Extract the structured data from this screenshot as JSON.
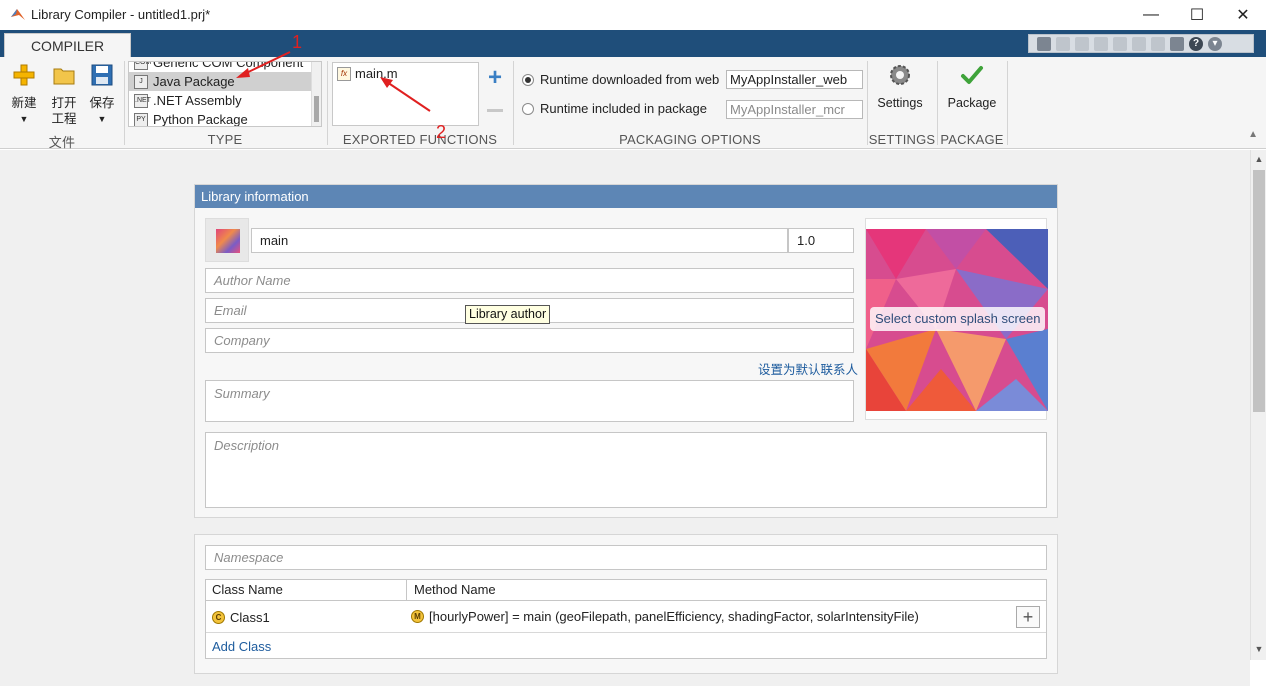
{
  "window": {
    "title": "Library Compiler - untitled1.prj*",
    "minimize": "—",
    "maximize": "☐",
    "close": "✕"
  },
  "tabs": {
    "compiler": "COMPILER"
  },
  "file_section": {
    "new_label": "新建",
    "open_label_1": "打开",
    "open_label_2": "工程",
    "save_label": "保存",
    "section_label": "文件"
  },
  "type_section": {
    "section_label": "TYPE",
    "items": [
      {
        "label": "Generic COM Component",
        "icon": "COM"
      },
      {
        "label": "Java Package",
        "icon": "J"
      },
      {
        "label": ".NET Assembly",
        "icon": ".NET"
      },
      {
        "label": "Python Package",
        "icon": "PY"
      }
    ],
    "selected": "Java Package"
  },
  "exported_functions": {
    "section_label": "EXPORTED FUNCTIONS",
    "files": [
      "main.m"
    ],
    "add_symbol": "+",
    "fx": "fx"
  },
  "packaging_options": {
    "section_label": "PACKAGING OPTIONS",
    "web_label": "Runtime downloaded from web",
    "web_value": "MyAppInstaller_web",
    "included_label": "Runtime included in package",
    "included_value": "MyAppInstaller_mcr",
    "selected": "web"
  },
  "settings": {
    "button_label": "Settings",
    "section_label": "SETTINGS"
  },
  "package": {
    "button_label": "Package",
    "section_label": "PACKAGE"
  },
  "annotations": {
    "one": "1",
    "two": "2"
  },
  "library_info": {
    "header": "Library information",
    "name": "main",
    "version": "1.0",
    "author_placeholder": "Author Name",
    "email_placeholder": "Email",
    "company_placeholder": "Company",
    "set_default_contact": "设置为默认联系人",
    "summary_placeholder": "Summary",
    "description_placeholder": "Description",
    "splash_button": "Select custom splash screen",
    "tooltip": "Library author"
  },
  "classes": {
    "namespace_placeholder": "Namespace",
    "col_class": "Class Name",
    "col_method": "Method Name",
    "rows": [
      {
        "class_badge": "C",
        "class_name": "Class1",
        "method_badge": "M",
        "method": "[hourlyPower] = main (geoFilepath, panelEfficiency, shadingFactor, solarIntensityFile)"
      }
    ],
    "add_method_symbol": "+",
    "add_class": "Add Class"
  },
  "colors": {
    "accent": "#1f4e7a",
    "panel_header": "#5d86b5",
    "link": "#1e5c9e",
    "annotation": "#e02020"
  }
}
